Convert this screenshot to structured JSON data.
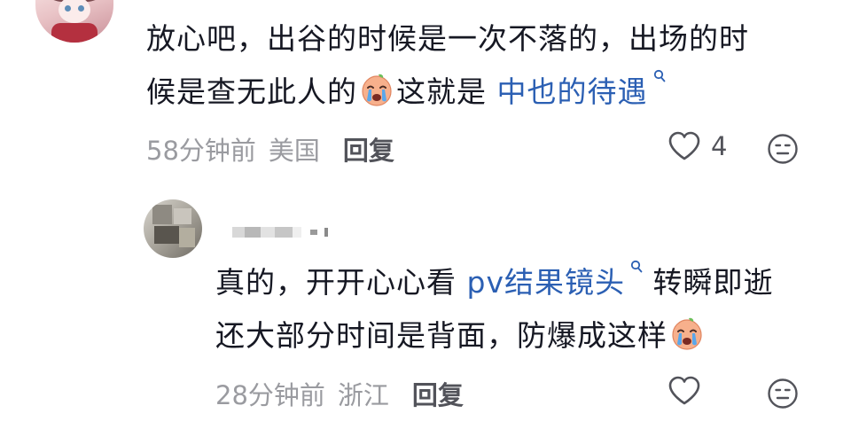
{
  "comments": [
    {
      "text_part1": "放心吧，出谷的时候是一次不落的，出场的时",
      "text_part2": "候是查无此人的",
      "text_part3": "这就是 ",
      "search_link": "中也的待遇",
      "time": "58分钟前",
      "location": "美国",
      "reply_label": "回复",
      "like_count": "4"
    },
    {
      "text_part1": "真的，开开心心看 ",
      "search_link": "pv结果镜头",
      "text_part2": " 转瞬即逝",
      "text_part3": "还大部分时间是背面，防爆成这样",
      "time": "28分钟前",
      "location": "浙江",
      "reply_label": "回复",
      "like_count": ""
    }
  ],
  "colors": {
    "text": "#161823",
    "meta": "#9a9ba0",
    "link": "#2b5fb3",
    "icon": "#52535a"
  }
}
